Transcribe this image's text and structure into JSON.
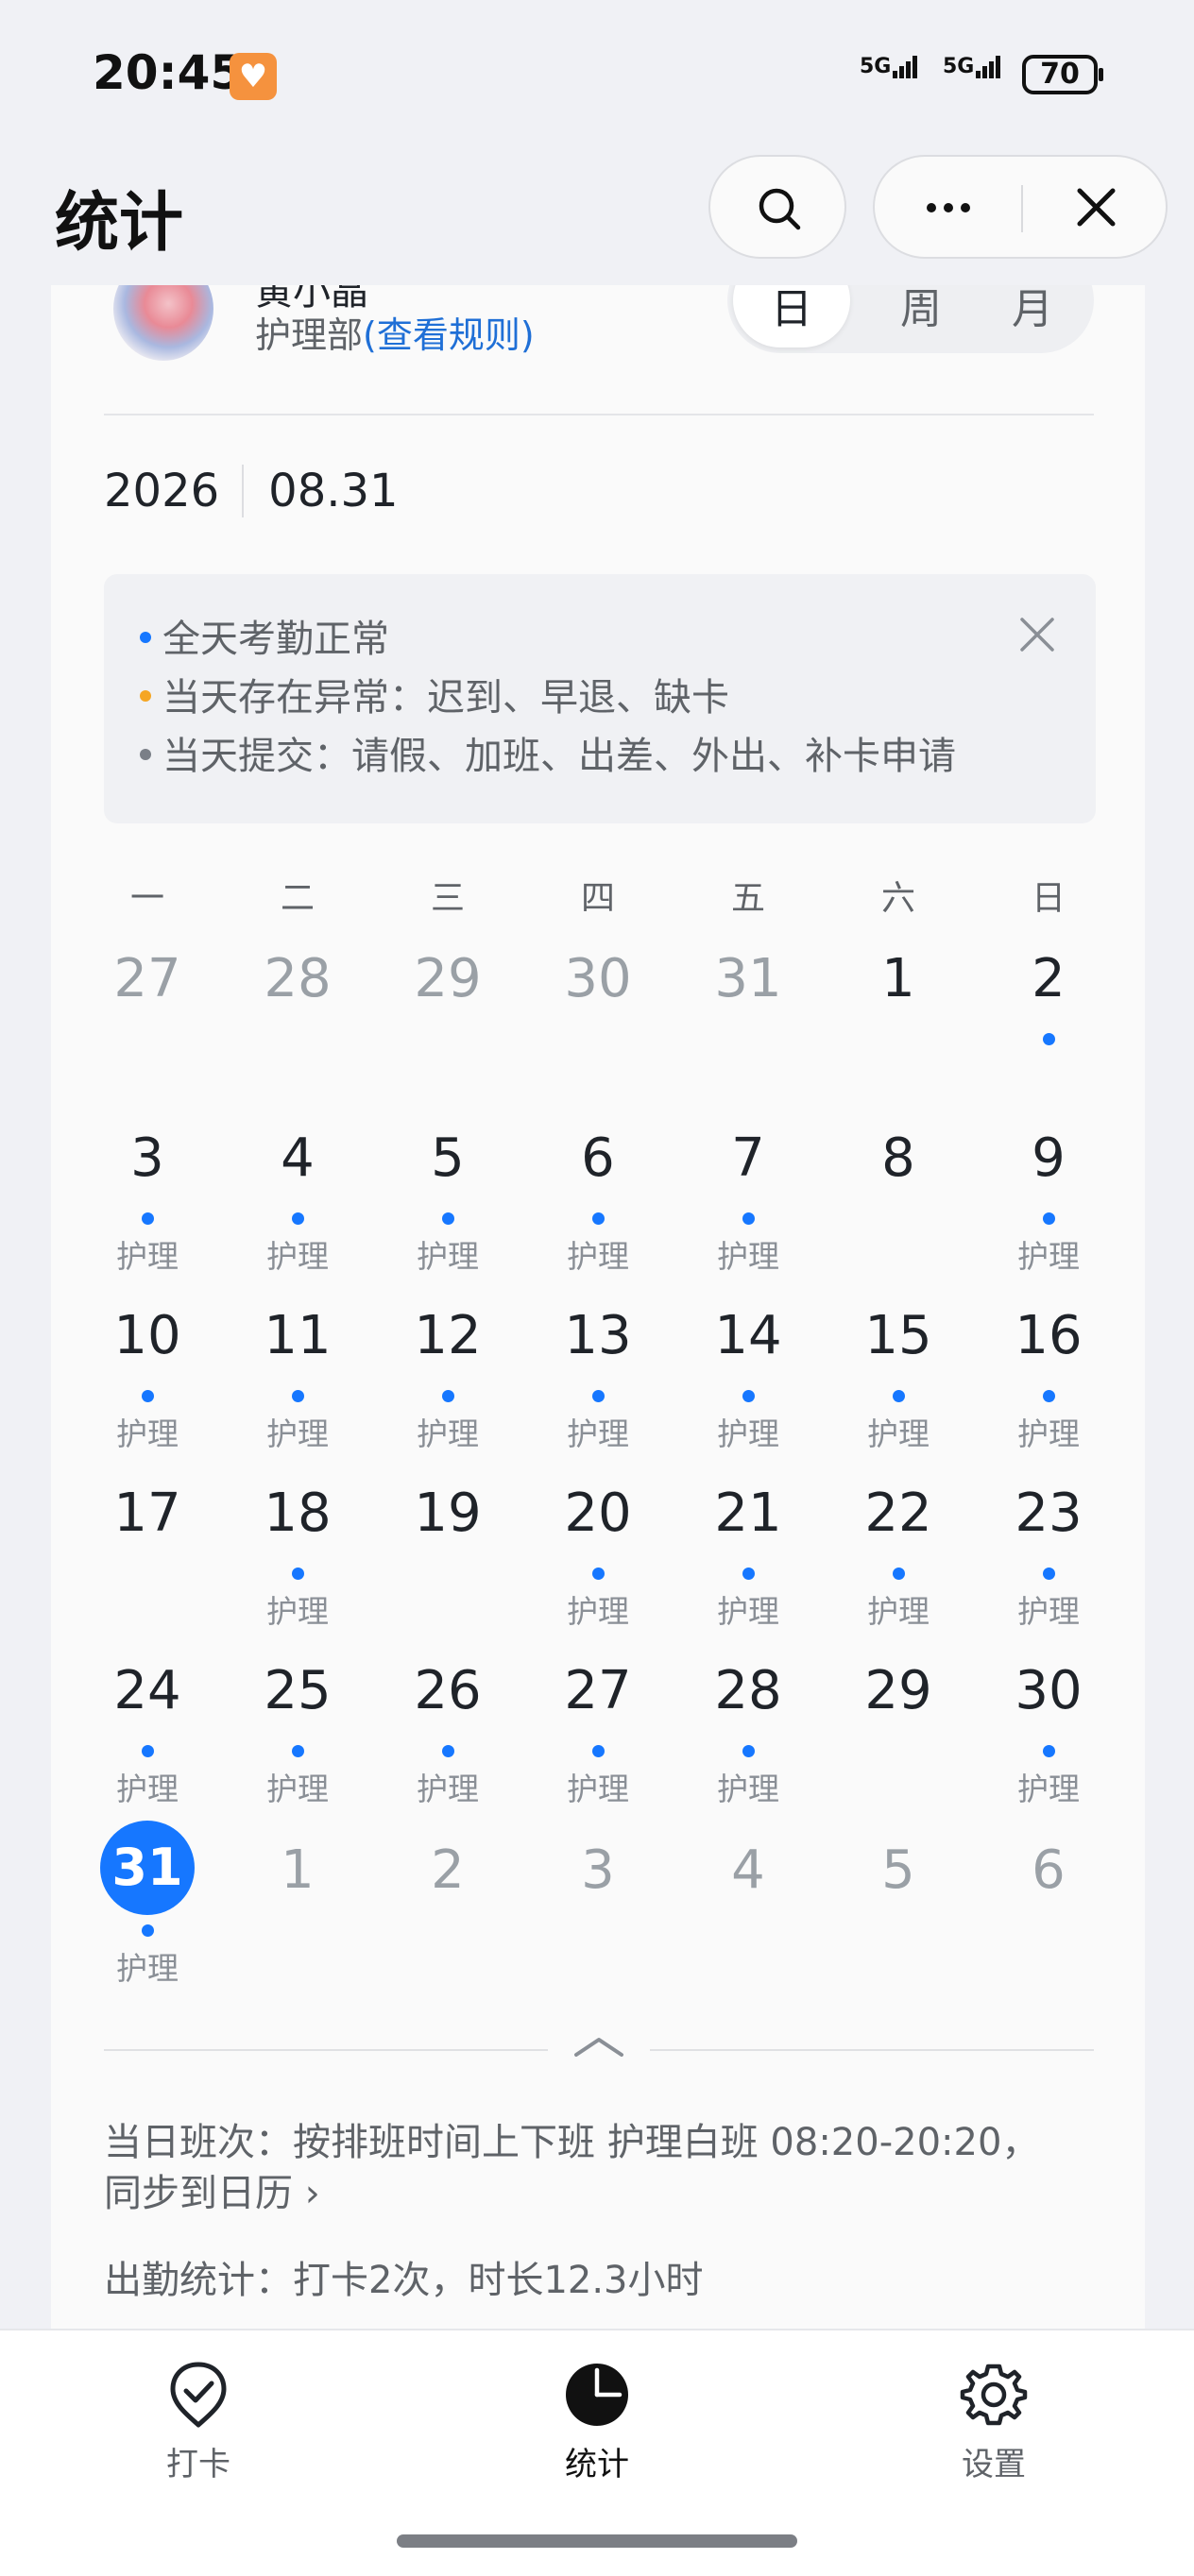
{
  "status_bar": {
    "time": "20:45",
    "signal1": "5G",
    "signal2": "5G",
    "battery": "70"
  },
  "header": {
    "title": "统计"
  },
  "profile": {
    "name": "黄小晶",
    "department": "护理部",
    "rules_link": "(查看规则)",
    "view_modes": [
      "日",
      "周",
      "月"
    ],
    "selected_mode": "日"
  },
  "date": {
    "year": "2026",
    "month_day": "08.31"
  },
  "legend": {
    "items": [
      {
        "text": "全天考勤正常",
        "color": "#1677ff"
      },
      {
        "text": "当天存在异常：迟到、早退、缺卡",
        "color": "#f5a623"
      },
      {
        "text": "当天提交：请假、加班、出差、外出、补卡申请",
        "color": "#7a7f87"
      }
    ]
  },
  "calendar": {
    "weekdays": [
      "一",
      "二",
      "三",
      "四",
      "五",
      "六",
      "日"
    ],
    "weeks": [
      [
        {
          "day": "27",
          "other": true,
          "dot": false,
          "tag": ""
        },
        {
          "day": "28",
          "other": true,
          "dot": false,
          "tag": ""
        },
        {
          "day": "29",
          "other": true,
          "dot": false,
          "tag": ""
        },
        {
          "day": "30",
          "other": true,
          "dot": false,
          "tag": ""
        },
        {
          "day": "31",
          "other": true,
          "dot": false,
          "tag": ""
        },
        {
          "day": "1",
          "other": false,
          "dot": false,
          "tag": ""
        },
        {
          "day": "2",
          "other": false,
          "dot": true,
          "tag": ""
        }
      ],
      [
        {
          "day": "3",
          "other": false,
          "dot": true,
          "tag": "护理"
        },
        {
          "day": "4",
          "other": false,
          "dot": true,
          "tag": "护理"
        },
        {
          "day": "5",
          "other": false,
          "dot": true,
          "tag": "护理"
        },
        {
          "day": "6",
          "other": false,
          "dot": true,
          "tag": "护理"
        },
        {
          "day": "7",
          "other": false,
          "dot": true,
          "tag": "护理"
        },
        {
          "day": "8",
          "other": false,
          "dot": false,
          "tag": ""
        },
        {
          "day": "9",
          "other": false,
          "dot": true,
          "tag": "护理"
        }
      ],
      [
        {
          "day": "10",
          "other": false,
          "dot": true,
          "tag": "护理"
        },
        {
          "day": "11",
          "other": false,
          "dot": true,
          "tag": "护理"
        },
        {
          "day": "12",
          "other": false,
          "dot": true,
          "tag": "护理"
        },
        {
          "day": "13",
          "other": false,
          "dot": true,
          "tag": "护理"
        },
        {
          "day": "14",
          "other": false,
          "dot": true,
          "tag": "护理"
        },
        {
          "day": "15",
          "other": false,
          "dot": true,
          "tag": "护理"
        },
        {
          "day": "16",
          "other": false,
          "dot": true,
          "tag": "护理"
        }
      ],
      [
        {
          "day": "17",
          "other": false,
          "dot": false,
          "tag": ""
        },
        {
          "day": "18",
          "other": false,
          "dot": true,
          "tag": "护理"
        },
        {
          "day": "19",
          "other": false,
          "dot": false,
          "tag": ""
        },
        {
          "day": "20",
          "other": false,
          "dot": true,
          "tag": "护理"
        },
        {
          "day": "21",
          "other": false,
          "dot": true,
          "tag": "护理"
        },
        {
          "day": "22",
          "other": false,
          "dot": true,
          "tag": "护理"
        },
        {
          "day": "23",
          "other": false,
          "dot": true,
          "tag": "护理"
        }
      ],
      [
        {
          "day": "24",
          "other": false,
          "dot": true,
          "tag": "护理"
        },
        {
          "day": "25",
          "other": false,
          "dot": true,
          "tag": "护理"
        },
        {
          "day": "26",
          "other": false,
          "dot": true,
          "tag": "护理"
        },
        {
          "day": "27",
          "other": false,
          "dot": true,
          "tag": "护理"
        },
        {
          "day": "28",
          "other": false,
          "dot": true,
          "tag": "护理"
        },
        {
          "day": "29",
          "other": false,
          "dot": false,
          "tag": ""
        },
        {
          "day": "30",
          "other": false,
          "dot": true,
          "tag": "护理"
        }
      ],
      [
        {
          "day": "31",
          "other": false,
          "dot": true,
          "tag": "护理",
          "today": true
        },
        {
          "day": "1",
          "other": true,
          "dot": false,
          "tag": ""
        },
        {
          "day": "2",
          "other": true,
          "dot": false,
          "tag": ""
        },
        {
          "day": "3",
          "other": true,
          "dot": false,
          "tag": ""
        },
        {
          "day": "4",
          "other": true,
          "dot": false,
          "tag": ""
        },
        {
          "day": "5",
          "other": true,
          "dot": false,
          "tag": ""
        },
        {
          "day": "6",
          "other": true,
          "dot": false,
          "tag": ""
        }
      ]
    ]
  },
  "summary": {
    "shift_line1": "当日班次：按排班时间上下班 护理白班 08:20-20:20，",
    "shift_line2": "同步到日历",
    "attendance": "出勤统计：打卡2次，时长12.3小时"
  },
  "tabbar": {
    "items": [
      {
        "label": "打卡",
        "icon": "check-badge-icon"
      },
      {
        "label": "统计",
        "icon": "pie-chart-icon",
        "active": true
      },
      {
        "label": "设置",
        "icon": "gear-icon"
      }
    ]
  },
  "colors": {
    "accent": "#1677ff",
    "link": "#1f6fd6",
    "warning": "#f5a623"
  }
}
